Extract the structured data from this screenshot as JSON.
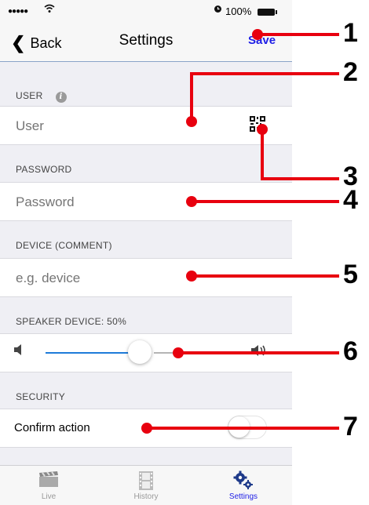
{
  "status_bar": {
    "signal": "●●●●●",
    "wifi": "⌔",
    "battery": "100%"
  },
  "nav": {
    "back_label": "Back",
    "title": "Settings",
    "save_label": "Save"
  },
  "sections": {
    "user": {
      "header": "USER",
      "placeholder": "User"
    },
    "password": {
      "header": "PASSWORD",
      "placeholder": "Password"
    },
    "device": {
      "header": "DEVICE (COMMENT)",
      "placeholder": "e.g. device"
    },
    "speaker": {
      "header": "SPEAKER DEVICE: 50%",
      "level": 0.5
    },
    "security": {
      "header": "SECURITY",
      "confirm_label": "Confirm action",
      "confirm_on": false
    }
  },
  "tabs": [
    {
      "label": "Live",
      "icon": "clapperboard-icon",
      "active": false
    },
    {
      "label": "History",
      "icon": "film-icon",
      "active": false
    },
    {
      "label": "Settings",
      "icon": "gears-icon",
      "active": true
    }
  ],
  "callouts": [
    "1",
    "2",
    "3",
    "4",
    "5",
    "6",
    "7"
  ],
  "colors": {
    "accent": "#1e1ee6",
    "slider": "#1e7bd9",
    "callout": "#e8000f"
  }
}
